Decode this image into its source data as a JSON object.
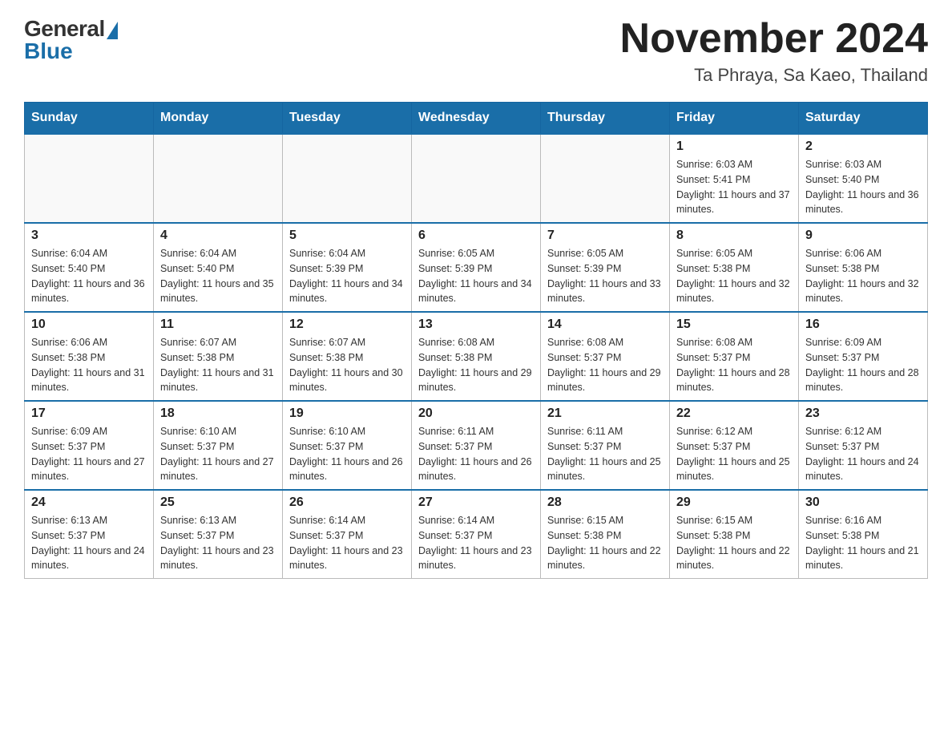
{
  "logo": {
    "general": "General",
    "blue": "Blue"
  },
  "header": {
    "title": "November 2024",
    "location": "Ta Phraya, Sa Kaeo, Thailand"
  },
  "weekdays": [
    "Sunday",
    "Monday",
    "Tuesday",
    "Wednesday",
    "Thursday",
    "Friday",
    "Saturday"
  ],
  "weeks": [
    [
      {
        "day": "",
        "info": ""
      },
      {
        "day": "",
        "info": ""
      },
      {
        "day": "",
        "info": ""
      },
      {
        "day": "",
        "info": ""
      },
      {
        "day": "",
        "info": ""
      },
      {
        "day": "1",
        "info": "Sunrise: 6:03 AM\nSunset: 5:41 PM\nDaylight: 11 hours and 37 minutes."
      },
      {
        "day": "2",
        "info": "Sunrise: 6:03 AM\nSunset: 5:40 PM\nDaylight: 11 hours and 36 minutes."
      }
    ],
    [
      {
        "day": "3",
        "info": "Sunrise: 6:04 AM\nSunset: 5:40 PM\nDaylight: 11 hours and 36 minutes."
      },
      {
        "day": "4",
        "info": "Sunrise: 6:04 AM\nSunset: 5:40 PM\nDaylight: 11 hours and 35 minutes."
      },
      {
        "day": "5",
        "info": "Sunrise: 6:04 AM\nSunset: 5:39 PM\nDaylight: 11 hours and 34 minutes."
      },
      {
        "day": "6",
        "info": "Sunrise: 6:05 AM\nSunset: 5:39 PM\nDaylight: 11 hours and 34 minutes."
      },
      {
        "day": "7",
        "info": "Sunrise: 6:05 AM\nSunset: 5:39 PM\nDaylight: 11 hours and 33 minutes."
      },
      {
        "day": "8",
        "info": "Sunrise: 6:05 AM\nSunset: 5:38 PM\nDaylight: 11 hours and 32 minutes."
      },
      {
        "day": "9",
        "info": "Sunrise: 6:06 AM\nSunset: 5:38 PM\nDaylight: 11 hours and 32 minutes."
      }
    ],
    [
      {
        "day": "10",
        "info": "Sunrise: 6:06 AM\nSunset: 5:38 PM\nDaylight: 11 hours and 31 minutes."
      },
      {
        "day": "11",
        "info": "Sunrise: 6:07 AM\nSunset: 5:38 PM\nDaylight: 11 hours and 31 minutes."
      },
      {
        "day": "12",
        "info": "Sunrise: 6:07 AM\nSunset: 5:38 PM\nDaylight: 11 hours and 30 minutes."
      },
      {
        "day": "13",
        "info": "Sunrise: 6:08 AM\nSunset: 5:38 PM\nDaylight: 11 hours and 29 minutes."
      },
      {
        "day": "14",
        "info": "Sunrise: 6:08 AM\nSunset: 5:37 PM\nDaylight: 11 hours and 29 minutes."
      },
      {
        "day": "15",
        "info": "Sunrise: 6:08 AM\nSunset: 5:37 PM\nDaylight: 11 hours and 28 minutes."
      },
      {
        "day": "16",
        "info": "Sunrise: 6:09 AM\nSunset: 5:37 PM\nDaylight: 11 hours and 28 minutes."
      }
    ],
    [
      {
        "day": "17",
        "info": "Sunrise: 6:09 AM\nSunset: 5:37 PM\nDaylight: 11 hours and 27 minutes."
      },
      {
        "day": "18",
        "info": "Sunrise: 6:10 AM\nSunset: 5:37 PM\nDaylight: 11 hours and 27 minutes."
      },
      {
        "day": "19",
        "info": "Sunrise: 6:10 AM\nSunset: 5:37 PM\nDaylight: 11 hours and 26 minutes."
      },
      {
        "day": "20",
        "info": "Sunrise: 6:11 AM\nSunset: 5:37 PM\nDaylight: 11 hours and 26 minutes."
      },
      {
        "day": "21",
        "info": "Sunrise: 6:11 AM\nSunset: 5:37 PM\nDaylight: 11 hours and 25 minutes."
      },
      {
        "day": "22",
        "info": "Sunrise: 6:12 AM\nSunset: 5:37 PM\nDaylight: 11 hours and 25 minutes."
      },
      {
        "day": "23",
        "info": "Sunrise: 6:12 AM\nSunset: 5:37 PM\nDaylight: 11 hours and 24 minutes."
      }
    ],
    [
      {
        "day": "24",
        "info": "Sunrise: 6:13 AM\nSunset: 5:37 PM\nDaylight: 11 hours and 24 minutes."
      },
      {
        "day": "25",
        "info": "Sunrise: 6:13 AM\nSunset: 5:37 PM\nDaylight: 11 hours and 23 minutes."
      },
      {
        "day": "26",
        "info": "Sunrise: 6:14 AM\nSunset: 5:37 PM\nDaylight: 11 hours and 23 minutes."
      },
      {
        "day": "27",
        "info": "Sunrise: 6:14 AM\nSunset: 5:37 PM\nDaylight: 11 hours and 23 minutes."
      },
      {
        "day": "28",
        "info": "Sunrise: 6:15 AM\nSunset: 5:38 PM\nDaylight: 11 hours and 22 minutes."
      },
      {
        "day": "29",
        "info": "Sunrise: 6:15 AM\nSunset: 5:38 PM\nDaylight: 11 hours and 22 minutes."
      },
      {
        "day": "30",
        "info": "Sunrise: 6:16 AM\nSunset: 5:38 PM\nDaylight: 11 hours and 21 minutes."
      }
    ]
  ]
}
